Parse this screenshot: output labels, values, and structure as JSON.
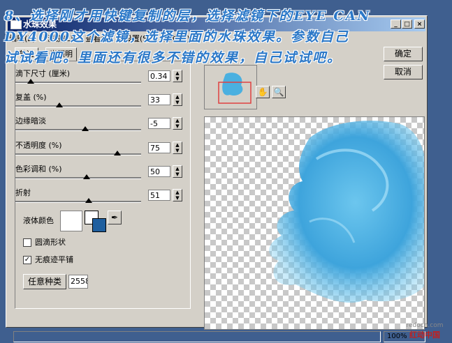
{
  "window": {
    "title": "水珠效果",
    "minimize": "_",
    "maximize": "□",
    "close": "×"
  },
  "menu": [
    "编辑(E)",
    "滤镜(L)",
    "查看(V)",
    "设置(S)",
    "帮助(H)"
  ],
  "tabs": {
    "normal": "普通",
    "lighting": "光照明"
  },
  "buttons": {
    "ok": "确定",
    "cancel": "取消",
    "random": "任意种类"
  },
  "seed": "2558",
  "params": [
    {
      "label": "滴下尺寸 (厘米)",
      "value": "0.34",
      "position": 0.05
    },
    {
      "label": "复盖 (%)",
      "value": "33",
      "position": 0.29
    },
    {
      "label": "边缘暗淡",
      "value": "-5",
      "position": 0.5
    },
    {
      "label": "不透明度 (%)",
      "value": "75",
      "position": 0.73
    },
    {
      "label": "色彩调和 (%)",
      "value": "50",
      "position": 0.53
    },
    {
      "label": "折射",
      "value": "51",
      "position": 0.54
    }
  ],
  "liquid_color": {
    "label": "液体颜色",
    "color": "#ffffff",
    "fg": "#ffffff",
    "bg": "#1f5f9f"
  },
  "checkboxes": [
    {
      "label": "圆滴形状",
      "checked": false
    },
    {
      "label": "无痕迹平铺",
      "checked": true
    }
  ],
  "tools": {
    "hand": "hand-icon",
    "zoom": "magnifier-icon"
  },
  "status": {
    "zoom": "100%"
  },
  "caption": [
    "8、选择刚才用快键复制的层，选择滤镜下的EYE CAN",
    "DY4000这个滤镜，选择里面的水珠效果。参数自己",
    "试试看吧。里面还有很多不错的效果，自己试试吧。"
  ],
  "watermark": {
    "site": "redocn.com",
    "name": "红动中国"
  },
  "colors": {
    "accent": "#0a246a",
    "water": "#4ab0e0",
    "caption": "#2b78c8"
  }
}
